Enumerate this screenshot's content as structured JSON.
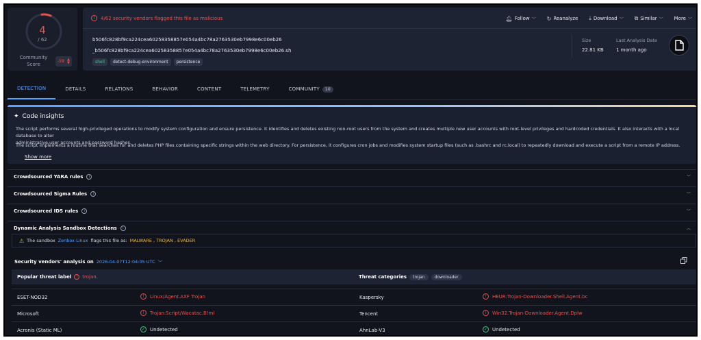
{
  "score": {
    "detections": 4,
    "total": "/ 62",
    "community_label": "Community Score",
    "community_value": "-59"
  },
  "header": {
    "alert": "4/62 security vendors flagged this file as malicious",
    "actions": [
      {
        "label": "Follow",
        "icon": "bell-icon"
      },
      {
        "label": "Reanalyze",
        "icon": "refresh-icon"
      },
      {
        "label": "Download",
        "icon": "download-icon"
      },
      {
        "label": "Similar",
        "icon": "similar-icon"
      },
      {
        "label": "More",
        "icon": "chevron-down-icon"
      }
    ],
    "hash": "b506fc828bf9ca224cea60258358857e054a4bc78a2763530eb7998e6c00eb26",
    "filename": "_b506fc828bf9ca224cea60258358857e054a4bc78a2763530eb7998e6c00eb26.sh",
    "tags": [
      "shell",
      "detect-debug-environment",
      "persistence"
    ],
    "size_label": "Size",
    "size_value": "22.81 KB",
    "last_analysis_label": "Last Analysis Date",
    "last_analysis_value": "1 month ago"
  },
  "tabs": [
    {
      "label": "DETECTION"
    },
    {
      "label": "DETAILS"
    },
    {
      "label": "RELATIONS"
    },
    {
      "label": "BEHAVIOR"
    },
    {
      "label": "CONTENT"
    },
    {
      "label": "TELEMETRY"
    },
    {
      "label": "COMMUNITY",
      "count": "10"
    }
  ],
  "insights": {
    "title": "Code insights",
    "p1_line1": "The script performs several high-privileged operations to modify system configuration and ensure persistence. It identifies and deletes existing non-root users from the system and creates multiple new user accounts with root-level privileges and hardcoded credentials. It also interacts with a local database to alter",
    "p1_line2": "administrative user accounts and password hashes.",
    "p2": "The script implements a routine that searches for and deletes PHP files containing specific strings within the web directory. For persistence, it configures cron jobs and modifies system startup files (such as .bashrc and rc.local) to repeatedly download and execute a script from a remote IP address.",
    "show_more": "Show more"
  },
  "sections": {
    "yara": "Crowdsourced YARA rules",
    "sigma": "Crowdsourced Sigma Rules",
    "ids": "Crowdsourced IDS rules",
    "sandbox": "Dynamic Analysis Sandbox Detections"
  },
  "sandbox": {
    "prefix": "The sandbox",
    "name": "Zenbox Linux",
    "middle": "flags this file as:",
    "flags": "MALWARE , TROJAN , EVADER"
  },
  "vendors": {
    "title": "Security vendors' analysis on",
    "date": "2026-04-07T12:04:05 UTC",
    "popular_label": "Popular threat label",
    "popular_value": "trojan.",
    "categories_label": "Threat categories",
    "categories": [
      "trojan",
      "downloader"
    ],
    "rows": [
      {
        "left_name": "ESET-NOD32",
        "left_result": "Linux/Agent.AXF Trojan",
        "left_status": "malicious",
        "right_name": "Kaspersky",
        "right_result": "HEUR:Trojan-Downloader.Shell.Agent.bc",
        "right_status": "malicious"
      },
      {
        "left_name": "Microsoft",
        "left_result": "Trojan:Script/Wacatac.B!ml",
        "left_status": "malicious",
        "right_name": "Tencent",
        "right_result": "Win32.Trojan-Downloader.Agent.Dplw",
        "right_status": "malicious"
      },
      {
        "left_name": "Acronis (Static ML)",
        "left_result": "Undetected",
        "left_status": "undetected",
        "right_name": "AhnLab-V3",
        "right_result": "Undetected",
        "right_status": "undetected"
      }
    ]
  },
  "colors": {
    "accent": "#5aa2ff",
    "danger": "#e25553",
    "ok": "#4cc38a",
    "warn": "#e9b949"
  }
}
